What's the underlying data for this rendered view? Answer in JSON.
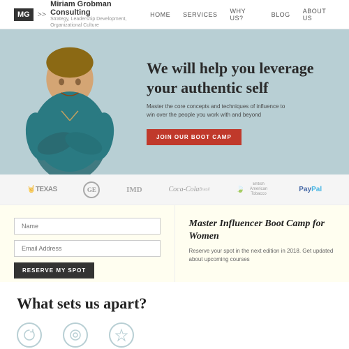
{
  "nav": {
    "logo_abbr": "MG",
    "logo_separator": ">>",
    "logo_title": "Miriam Grobman Consulting",
    "logo_sub": "Strategy, Leadership Development, Organizational Culture",
    "links": [
      {
        "label": "HOME",
        "name": "nav-home"
      },
      {
        "label": "SERVICES",
        "name": "nav-services"
      },
      {
        "label": "WHY US?",
        "name": "nav-why"
      },
      {
        "label": "BLOG",
        "name": "nav-blog"
      },
      {
        "label": "ABOUT US",
        "name": "nav-about"
      }
    ]
  },
  "hero": {
    "title": "We will help you leverage your authentic self",
    "subtitle": "Master the core concepts and techniques of influence to win over the people you work with and beyond",
    "cta_label": "JOIN OUR BOOT CAMP",
    "bg_color": "#b8cfd4"
  },
  "logos": [
    {
      "label": "🤘TEXAS",
      "type": "texas"
    },
    {
      "label": "GE",
      "type": "ge"
    },
    {
      "label": "IMD",
      "type": "imd"
    },
    {
      "label": "Coca-Cola",
      "type": "coca"
    },
    {
      "label": "British American Tobacco",
      "type": "bat"
    },
    {
      "label": "PayPal",
      "type": "paypal"
    }
  ],
  "form_panel": {
    "name_placeholder": "Name",
    "email_placeholder": "Email Address",
    "btn_label": "RESERVE MY SPOT"
  },
  "promo_panel": {
    "title": "Master Influencer Boot Camp for Women",
    "text": "Reserve your spot in the next edition in 2018. Get updated about upcoming courses"
  },
  "bottom": {
    "title": "What sets us apart?",
    "icons": [
      {
        "symbol": "↻"
      },
      {
        "symbol": "◎"
      },
      {
        "symbol": "✦"
      }
    ]
  }
}
